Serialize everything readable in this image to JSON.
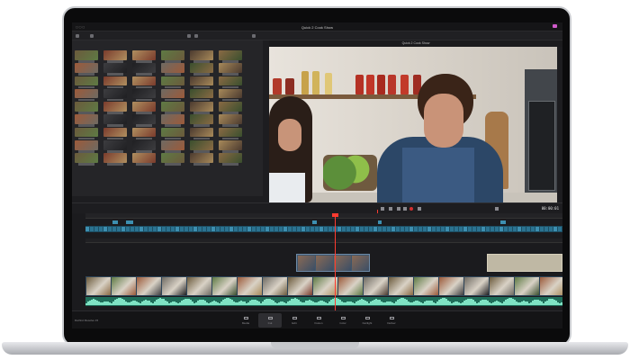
{
  "window": {
    "title": "Quick 2 Cook Show",
    "viewer_title": "Quick 2 Cook Show",
    "timecode": "00:00:01"
  },
  "pages": [
    "Media",
    "Cut",
    "Edit",
    "Fusion",
    "Color",
    "Fairlight",
    "Deliver"
  ],
  "active_page": "Cut",
  "app_name": "DaVinci Resolve 15",
  "colors": {
    "accent": "#ff3b30",
    "video_track": "#2e4458",
    "audio_track": "#1f6e5a"
  }
}
